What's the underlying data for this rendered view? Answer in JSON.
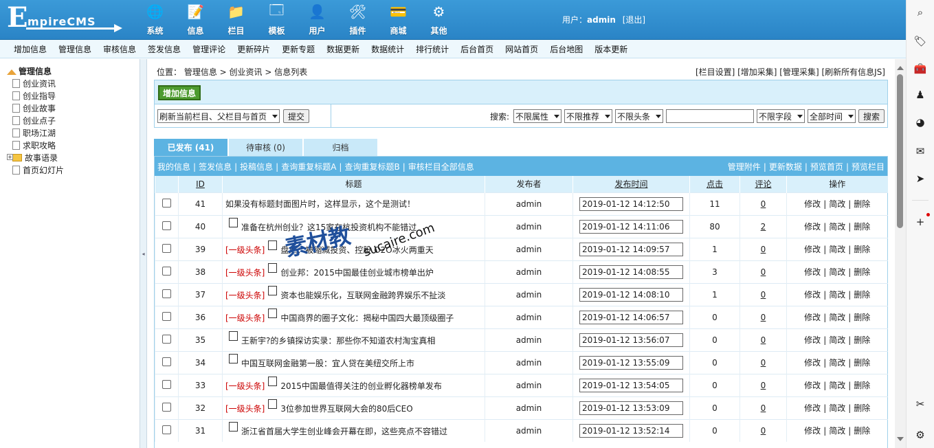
{
  "logo": {
    "initial": "E",
    "rest": "mpireCMS"
  },
  "topnav": [
    {
      "label": "系统",
      "icon": "globe-icon",
      "glyph": "🌐"
    },
    {
      "label": "信息",
      "icon": "notepad-icon",
      "glyph": "📝"
    },
    {
      "label": "栏目",
      "icon": "folder-icon",
      "glyph": "📁"
    },
    {
      "label": "模板",
      "icon": "window-icon",
      "glyph": "🗔"
    },
    {
      "label": "用户",
      "icon": "user-icon",
      "glyph": "👤"
    },
    {
      "label": "插件",
      "icon": "tools-icon",
      "glyph": "🛠"
    },
    {
      "label": "商城",
      "icon": "card-icon",
      "glyph": "💳"
    },
    {
      "label": "其他",
      "icon": "gear-icon",
      "glyph": "⚙"
    }
  ],
  "user": {
    "prefix": "用户：",
    "name": "admin",
    "logout": "[退出]"
  },
  "menubar": [
    "增加信息",
    "管理信息",
    "审核信息",
    "签发信息",
    "管理评论",
    "更新碎片",
    "更新专题",
    "数据更新",
    "数据统计",
    "排行统计",
    "后台首页",
    "网站首页",
    "后台地图",
    "版本更新"
  ],
  "sidebar": {
    "root": "管理信息",
    "items": [
      {
        "label": "创业资讯",
        "type": "doc"
      },
      {
        "label": "创业指导",
        "type": "doc"
      },
      {
        "label": "创业故事",
        "type": "doc"
      },
      {
        "label": "创业点子",
        "type": "doc"
      },
      {
        "label": "职场江湖",
        "type": "doc"
      },
      {
        "label": "求职攻略",
        "type": "doc"
      },
      {
        "label": "故事语录",
        "type": "folder"
      },
      {
        "label": "首页幻灯片",
        "type": "doc"
      }
    ]
  },
  "breadcrumb": {
    "prefix": "位置：",
    "l1": "管理信息",
    "sep": " > ",
    "l2": "创业资讯",
    "l3": "信息列表"
  },
  "toplinks": "[栏目设置] [增加采集] [管理采集] [刷新所有信息JS]",
  "add_button": "增加信息",
  "refresh_select": "刷新当前栏目、父栏目与首页",
  "submit_label": "提交",
  "search": {
    "label": "搜索:",
    "attr": "不限属性",
    "recommend": "不限推荐",
    "headline": "不限头条",
    "field": "不限字段",
    "time": "全部时间",
    "button": "搜索"
  },
  "tabs": [
    "已发布 (41)",
    "待审核 (0)",
    "归档"
  ],
  "subbar": {
    "left": [
      "我的信息",
      "签发信息",
      "投稿信息",
      "查询重复标题A",
      "查询重复标题B",
      "审核栏目全部信息"
    ],
    "right": [
      "管理附件",
      "更新数据",
      "预览首页",
      "预览栏目"
    ]
  },
  "columns": {
    "id": "ID",
    "title": "标题",
    "author": "发布者",
    "time": "发布时间",
    "clicks": "点击",
    "comments": "评论",
    "ops": "操作"
  },
  "ops": {
    "edit": "修改",
    "simple": "简改",
    "del": "删除",
    "sep": "|"
  },
  "rows": [
    {
      "id": "41",
      "tag": "",
      "doc": false,
      "title": "如果没有标题封面图片时，这样显示，这个是测试！",
      "author": "admin",
      "time": "2019-01-12 14:12:50",
      "clicks": "11",
      "comments": "0"
    },
    {
      "id": "40",
      "tag": "",
      "doc": true,
      "title": "准备在杭州创业？这15家在杭投资机构不能错过",
      "author": "admin",
      "time": "2019-01-12 14:11:06",
      "clicks": "80",
      "comments": "2"
    },
    {
      "id": "39",
      "tag": "[一级头条]",
      "doc": true,
      "title": "盘点：被缩减投资、控股 O2O冰火两重天",
      "author": "admin",
      "time": "2019-01-12 14:09:57",
      "clicks": "1",
      "comments": "0"
    },
    {
      "id": "38",
      "tag": "[一级头条]",
      "doc": true,
      "title": "创业邦：2015中国最佳创业城市榜单出炉",
      "author": "admin",
      "time": "2019-01-12 14:08:55",
      "clicks": "3",
      "comments": "0"
    },
    {
      "id": "37",
      "tag": "[一级头条]",
      "doc": true,
      "title": "资本也能娱乐化，互联网金融跨界娱乐不扯淡",
      "author": "admin",
      "time": "2019-01-12 14:08:10",
      "clicks": "1",
      "comments": "0"
    },
    {
      "id": "36",
      "tag": "[一级头条]",
      "doc": true,
      "title": "中国商界的圈子文化：揭秘中国四大最顶级圈子",
      "author": "admin",
      "time": "2019-01-12 14:06:57",
      "clicks": "0",
      "comments": "0"
    },
    {
      "id": "35",
      "tag": "",
      "doc": true,
      "title": "王新宇?的乡镇探访实录：那些你不知道农村淘宝真相",
      "author": "admin",
      "time": "2019-01-12 13:56:07",
      "clicks": "0",
      "comments": "0"
    },
    {
      "id": "34",
      "tag": "",
      "doc": true,
      "title": "中国互联网金融第一股：宜人贷在美纽交所上市",
      "author": "admin",
      "time": "2019-01-12 13:55:09",
      "clicks": "0",
      "comments": "0"
    },
    {
      "id": "33",
      "tag": "[一级头条]",
      "doc": true,
      "title": "2015中国最值得关注的创业孵化器榜单发布",
      "author": "admin",
      "time": "2019-01-12 13:54:05",
      "clicks": "0",
      "comments": "0"
    },
    {
      "id": "32",
      "tag": "[一级头条]",
      "doc": true,
      "title": "3位参加世界互联网大会的80后CEO",
      "author": "admin",
      "time": "2019-01-12 13:53:09",
      "clicks": "0",
      "comments": "0"
    },
    {
      "id": "31",
      "tag": "",
      "doc": true,
      "title": "浙江省首届大学生创业峰会开幕在即，这些亮点不容错过",
      "author": "admin",
      "time": "2019-01-12 13:52:14",
      "clicks": "0",
      "comments": "0"
    }
  ],
  "watermark": {
    "cn": "素材教",
    "en": "sucaire.com"
  },
  "browser_sidebar": [
    "search-icon",
    "tag-icon",
    "toolbox-icon",
    "game-icon",
    "office-icon",
    "outlook-icon",
    "send-icon",
    "plus-icon",
    "screenshot-icon",
    "settings-icon"
  ]
}
